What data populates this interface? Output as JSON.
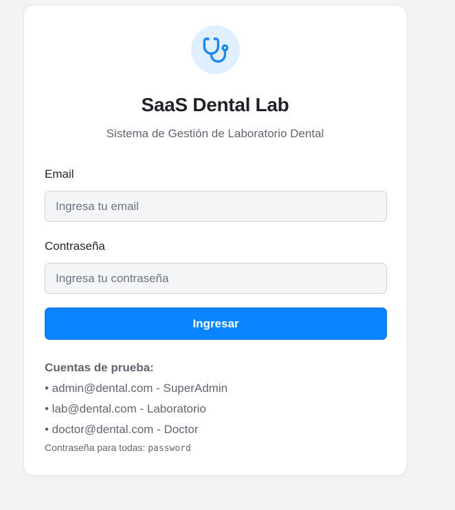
{
  "app": {
    "title": "SaaS Dental Lab",
    "subtitle": "Sistema de Gestión de Laboratorio Dental",
    "logo_icon": "stethoscope-icon",
    "accent_color": "#0a84ff"
  },
  "form": {
    "email_label": "Email",
    "email_placeholder": "Ingresa tu email",
    "email_value": "",
    "password_label": "Contraseña",
    "password_placeholder": "Ingresa tu contraseña",
    "password_value": "",
    "submit_label": "Ingresar"
  },
  "test_accounts": {
    "title": "Cuentas de prueba:",
    "items": [
      "• admin@dental.com - SuperAdmin",
      "• lab@dental.com - Laboratorio",
      "• doctor@dental.com - Doctor"
    ],
    "password_note_prefix": "Contraseña para todas: ",
    "password_value": "password"
  }
}
